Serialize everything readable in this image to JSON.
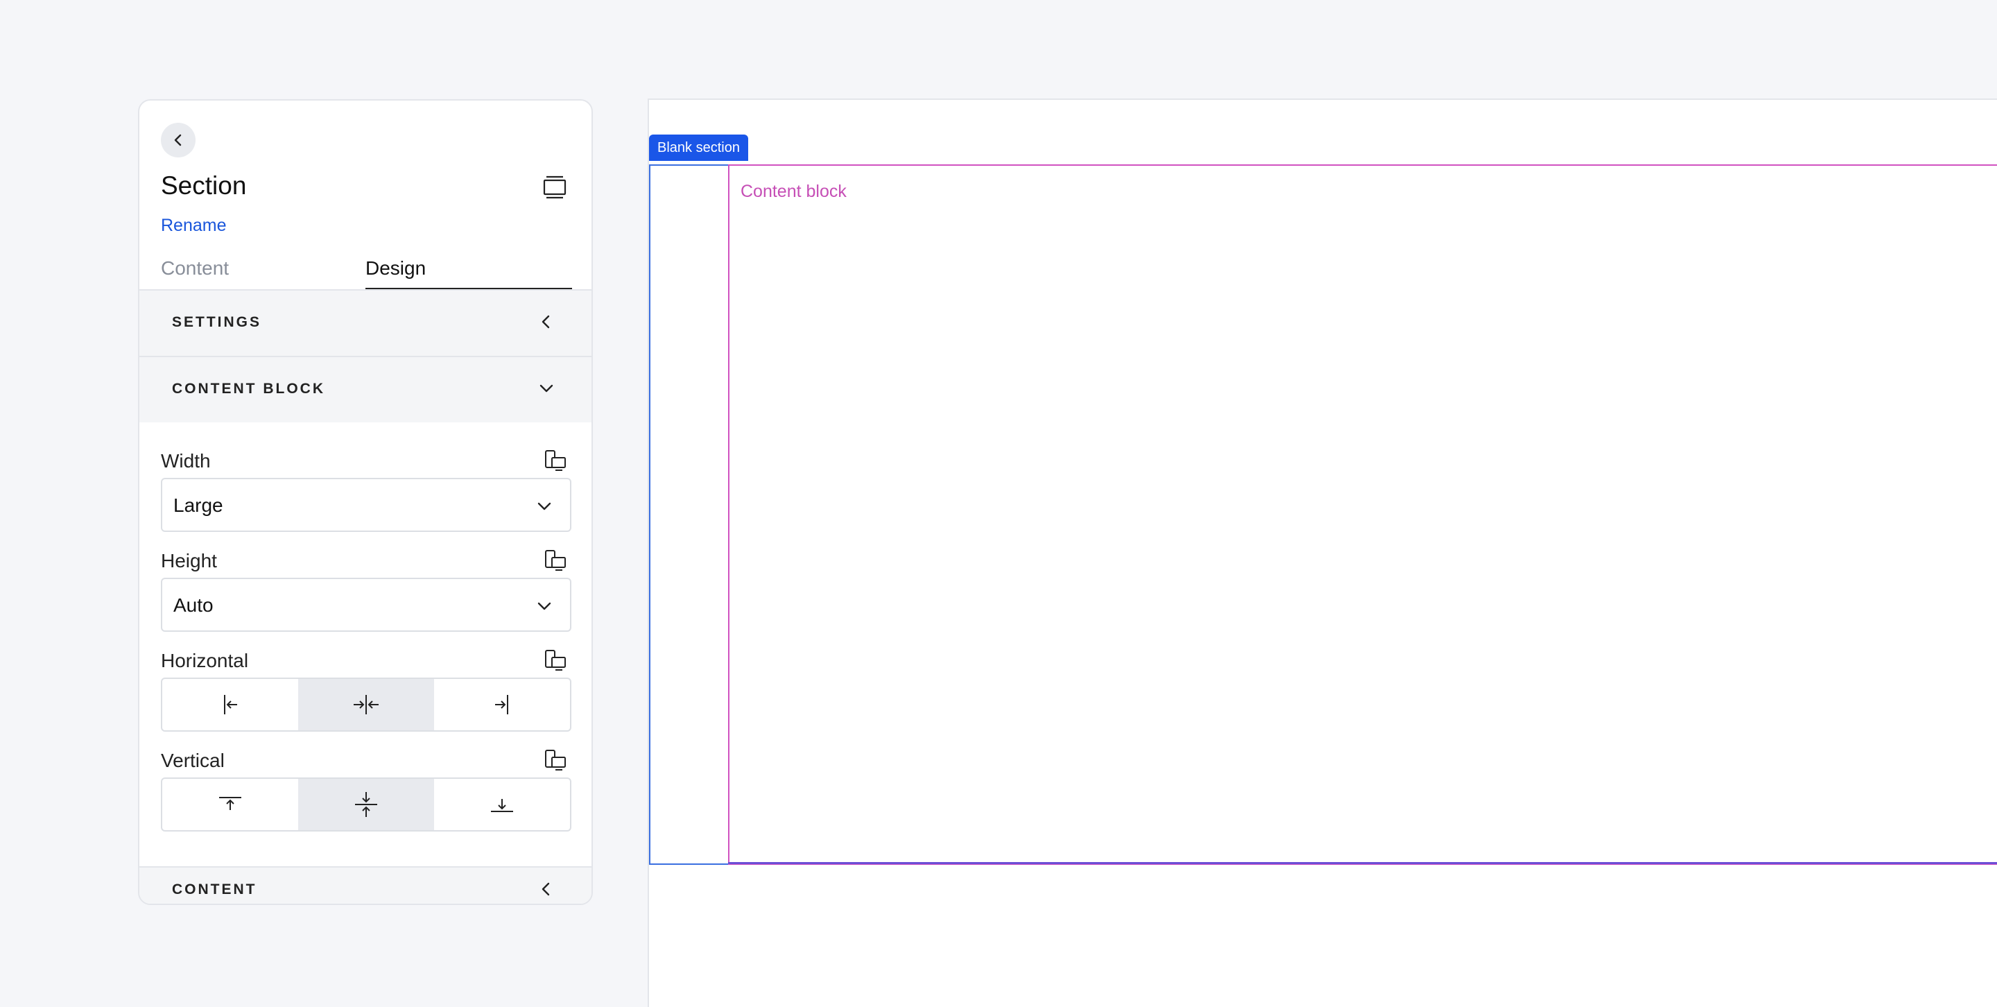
{
  "panel": {
    "title": "Section",
    "rename_label": "Rename",
    "tabs": [
      {
        "label": "Content",
        "active": false
      },
      {
        "label": "Design",
        "active": true
      }
    ],
    "sections": {
      "settings": "SETTINGS",
      "content_block": "CONTENT BLOCK",
      "content": "CONTENT"
    },
    "fields": {
      "width": {
        "label": "Width",
        "value": "Large"
      },
      "height": {
        "label": "Height",
        "value": "Auto"
      },
      "horizontal": {
        "label": "Horizontal",
        "options": [
          "align-left-icon",
          "align-center-horizontal-icon",
          "align-right-icon"
        ],
        "selected": 1
      },
      "vertical": {
        "label": "Vertical",
        "options": [
          "align-top-icon",
          "align-center-vertical-icon",
          "align-bottom-icon"
        ],
        "selected": 1
      }
    }
  },
  "canvas": {
    "section_tag": "Blank section",
    "content_block_label": "Content block"
  },
  "colors": {
    "accent": "#1a56e8",
    "link": "#1a56db",
    "content_block_outline": "#d152c1",
    "section_outline": "#3b6fe0"
  }
}
